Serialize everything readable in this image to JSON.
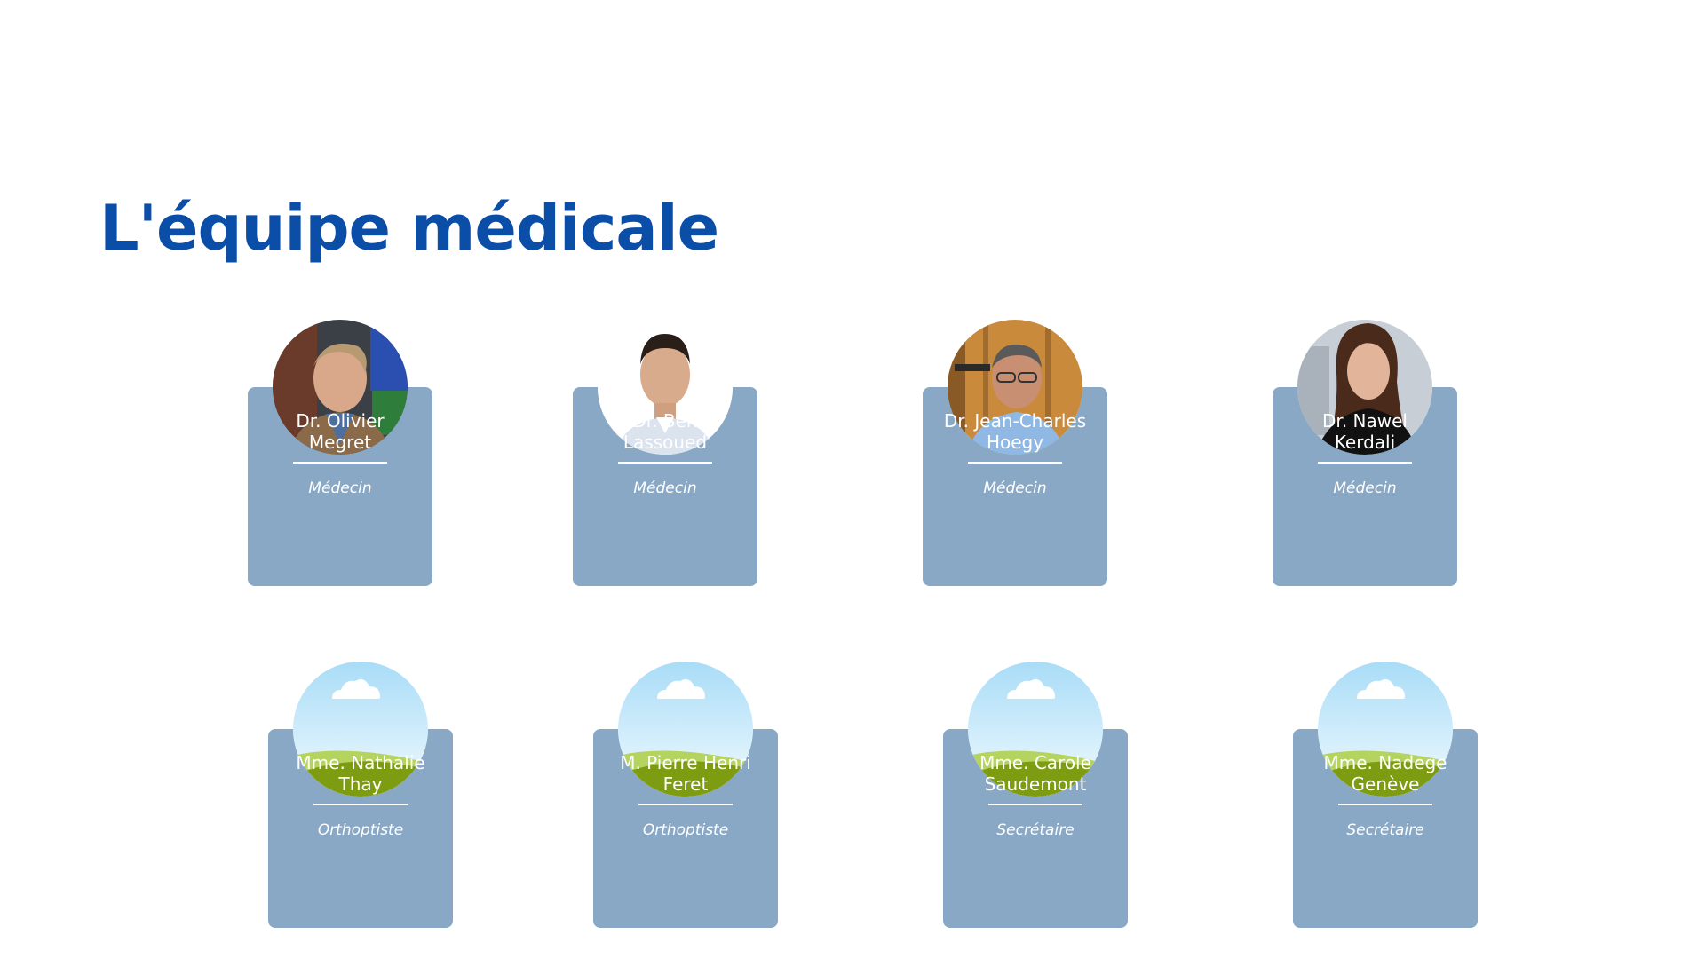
{
  "page": {
    "title": "L'équipe médicale"
  },
  "team": [
    {
      "name_line1": "Dr. Olivier",
      "name_line2": "Megret",
      "role": "Médecin",
      "photo": "portrait-photo"
    },
    {
      "name_line1": "Dr. Ben",
      "name_line2": "Lassoued",
      "role": "Médecin",
      "photo": "portrait-photo"
    },
    {
      "name_line1": "Dr. Jean-Charles",
      "name_line2": "Hoegy",
      "role": "Médecin",
      "photo": "portrait-photo"
    },
    {
      "name_line1": "Dr. Nawel",
      "name_line2": "Kerdali",
      "role": "Médecin",
      "photo": "portrait-photo"
    },
    {
      "name_line1": "Mme. Nathalie",
      "name_line2": "Thay",
      "role": "Orthoptiste",
      "photo": "landscape-placeholder-icon"
    },
    {
      "name_line1": "M. Pierre Henri",
      "name_line2": "Feret",
      "role": "Orthoptiste",
      "photo": "landscape-placeholder-icon"
    },
    {
      "name_line1": "Mme. Carole",
      "name_line2": "Saudemont",
      "role": "Secrétaire",
      "photo": "landscape-placeholder-icon"
    },
    {
      "name_line1": "Mme. Nadege",
      "name_line2": "Genève",
      "role": "Secrétaire",
      "photo": "landscape-placeholder-icon"
    }
  ],
  "colors": {
    "title": "#0b4ea8",
    "card": "#89a8c5",
    "card_text": "#ffffff"
  }
}
